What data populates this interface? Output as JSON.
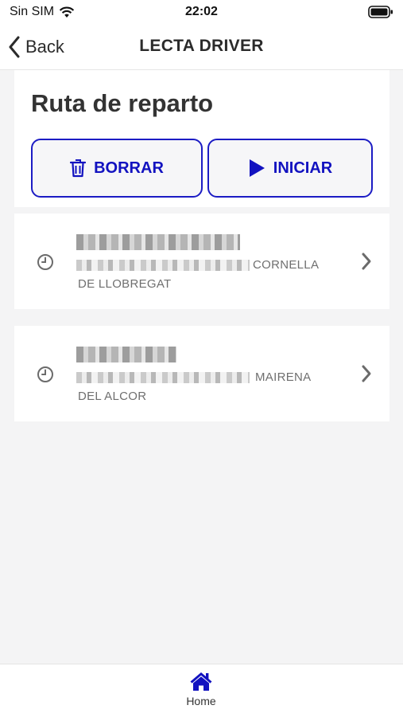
{
  "status_bar": {
    "carrier": "Sin SIM",
    "time": "22:02"
  },
  "nav": {
    "back_label": "Back",
    "title": "LECTA DRIVER"
  },
  "page": {
    "title": "Ruta de reparto"
  },
  "actions": {
    "delete_label": "BORRAR",
    "start_label": "INICIAR"
  },
  "deliveries": [
    {
      "address_tail": "CORNELLA",
      "city": "DE LLOBREGAT"
    },
    {
      "address_tail": "MAIRENA",
      "city": "DEL ALCOR"
    }
  ],
  "tab_bar": {
    "home_label": "Home"
  },
  "colors": {
    "accent": "#1212c0",
    "background": "#f4f4f5",
    "icon_gray": "#6b6b6b"
  }
}
